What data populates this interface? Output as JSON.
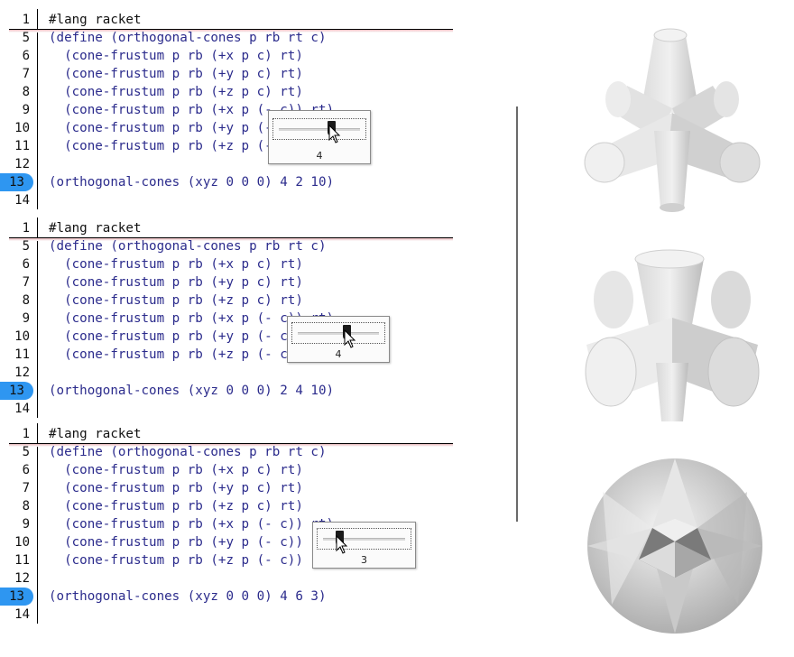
{
  "panels": [
    {
      "lang": "#lang racket",
      "lines": [
        {
          "n": "1"
        },
        {
          "n": "5"
        },
        {
          "n": "6"
        },
        {
          "n": "7"
        },
        {
          "n": "8"
        },
        {
          "n": "9"
        },
        {
          "n": "10"
        },
        {
          "n": "11"
        },
        {
          "n": "12"
        },
        {
          "n": "13"
        },
        {
          "n": "14"
        }
      ],
      "define": "(define (orthogonal-cones p rb rt c)",
      "body": [
        "  (cone-frustum p rb (+x p c) rt)",
        "  (cone-frustum p rb (+y p c) rt)",
        "  (cone-frustum p rb (+z p c) rt)",
        "  (cone-frustum p rb (+x p (- c)) rt)",
        "  (cone-frustum p rb (+y p (- c)) rt)",
        "  (cone-frustum p rb (+z p (- c)) rt))"
      ],
      "call": "(orthogonal-cones (xyz 0 0 0) 4 2 10)",
      "slider_value": "4"
    },
    {
      "lang": "#lang racket",
      "lines": [
        {
          "n": "1"
        },
        {
          "n": "5"
        },
        {
          "n": "6"
        },
        {
          "n": "7"
        },
        {
          "n": "8"
        },
        {
          "n": "9"
        },
        {
          "n": "10"
        },
        {
          "n": "11"
        },
        {
          "n": "12"
        },
        {
          "n": "13"
        },
        {
          "n": "14"
        }
      ],
      "define": "(define (orthogonal-cones p rb rt c)",
      "body": [
        "  (cone-frustum p rb (+x p c) rt)",
        "  (cone-frustum p rb (+y p c) rt)",
        "  (cone-frustum p rb (+z p c) rt)",
        "  (cone-frustum p rb (+x p (- c)) rt)",
        "  (cone-frustum p rb (+y p (- c)) rt)",
        "  (cone-frustum p rb (+z p (- c)) rt))"
      ],
      "call": "(orthogonal-cones (xyz 0 0 0) 2 4 10)",
      "slider_value": "4"
    },
    {
      "lang": "#lang racket",
      "lines": [
        {
          "n": "1"
        },
        {
          "n": "5"
        },
        {
          "n": "6"
        },
        {
          "n": "7"
        },
        {
          "n": "8"
        },
        {
          "n": "9"
        },
        {
          "n": "10"
        },
        {
          "n": "11"
        },
        {
          "n": "12"
        },
        {
          "n": "13"
        },
        {
          "n": "14"
        }
      ],
      "define": "(define (orthogonal-cones p rb rt c)",
      "body": [
        "  (cone-frustum p rb (+x p c) rt)",
        "  (cone-frustum p rb (+y p c) rt)",
        "  (cone-frustum p rb (+z p c) rt)",
        "  (cone-frustum p rb (+x p (- c)) rt)",
        "  (cone-frustum p rb (+y p (- c)) rt)",
        "  (cone-frustum p rb (+z p (- c)) rt))"
      ],
      "call": "(orthogonal-cones (xyz 0 0 0) 4 6 3)",
      "slider_value": "3"
    }
  ],
  "colors": {
    "keyword": "#2b2b8c",
    "paren": "#8a4a3a",
    "number": "#2e8b2e",
    "line_highlight": "#2e96f1"
  },
  "renders": [
    {
      "icon": "star-cone-render"
    },
    {
      "icon": "rounded-cone-render"
    },
    {
      "icon": "sphere-cone-render"
    }
  ]
}
